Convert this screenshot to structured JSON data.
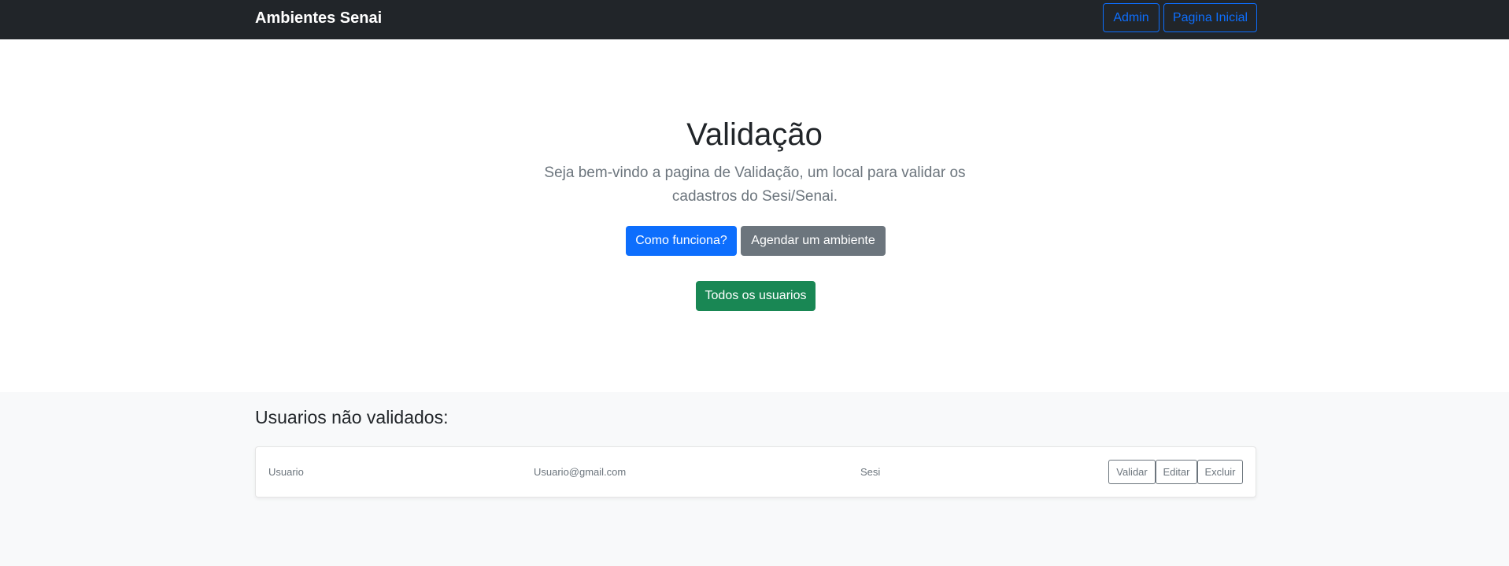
{
  "navbar": {
    "brand": "Ambientes Senai",
    "admin_label": "Admin",
    "home_label": "Pagina Inicial"
  },
  "hero": {
    "title": "Validação",
    "lead": "Seja bem-vindo a pagina de Validação, um local para validar os cadastros do Sesi/Senai.",
    "primary_label": "Como funciona?",
    "secondary_label": "Agendar um ambiente",
    "all_users_label": "Todos os usuarios"
  },
  "pending": {
    "heading": "Usuarios não validados:",
    "rows": [
      {
        "user": "Usuario",
        "email": "Usuario@gmail.com",
        "org": "Sesi",
        "validate_label": "Validar",
        "edit_label": "Editar",
        "delete_label": "Excluir"
      }
    ]
  },
  "colors": {
    "navbar_bg": "#212529",
    "primary": "#0d6efd",
    "secondary": "#6c757d",
    "success": "#198754",
    "section_bg": "#f8f9fa"
  }
}
